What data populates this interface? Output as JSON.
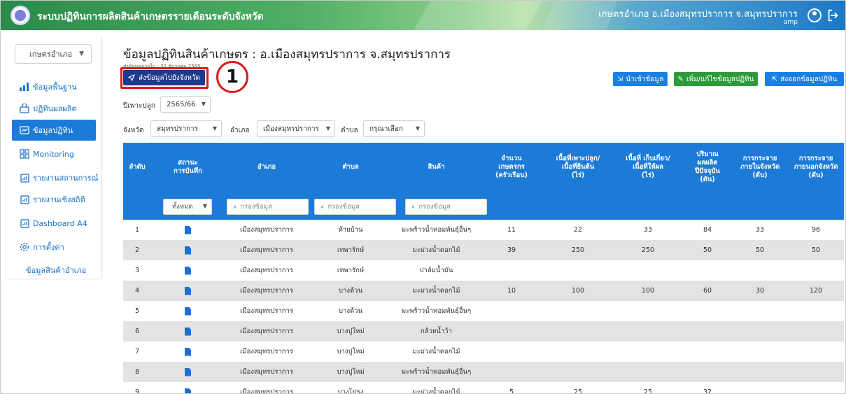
{
  "header": {
    "app_title": "ระบบปฏิทินการผลิตสินค้าเกษตรรายเดือนระดับจังหวัด",
    "user_office": "เกษตรอำเภอ อ.เมืองสมุทรปราการ จ.สมุทรปราการ",
    "user_name": "amp"
  },
  "sidebar": {
    "role": "เกษตรอำเภอ",
    "items": [
      {
        "label": "ข้อมูลพื้นฐาน",
        "icon": "bar-chart-icon"
      },
      {
        "label": "ปฏิทินผลผลิต",
        "icon": "bag-icon"
      },
      {
        "label": "ข้อมูลปฏิทิน",
        "icon": "calendar-chart-icon"
      },
      {
        "label": "Monitoring",
        "icon": "grid-icon"
      },
      {
        "label": "รายงานสถานการณ์",
        "icon": "report-icon"
      },
      {
        "label": "รายงานเชิงสถิติ",
        "icon": "report-icon"
      },
      {
        "label": "Dashboard A4",
        "icon": "report-icon"
      },
      {
        "label": "การตั้งค่า",
        "icon": "settings-icon"
      }
    ],
    "subitem": "ข้อมูลสินค้าอำเภอ"
  },
  "main": {
    "title": "ข้อมูลปฏิทินสินค้าเกษตร : อ.เมืองสมุทรปราการ จ.สมุทรปราการ",
    "last_sent": "ส่งข้อมูลภายใน : 31 ธันวาคม 2565",
    "send_button": "ส่งข้อมูลไปยังจังหวัด",
    "step_number": "1",
    "import_button": "นำเข้าข้อมูล",
    "add_button": "เพิ่ม/แก้ไขข้อมูลปฏิทิน",
    "export_button": "ส่งออกข้อมูลปฏิทิน",
    "season_label": "ปีเพาะปลูก",
    "season_value": "2565/66",
    "province_label": "จังหวัด",
    "province_value": "สมุทรปราการ",
    "district_label": "อำเภอ",
    "district_value": "เมืองสมุทรปราการ",
    "subdistrict_label": "ตำบล",
    "subdistrict_value": "กรุณาเลือก"
  },
  "table": {
    "headers": [
      "ลำดับ",
      "สถานะ\nการบันทึก",
      "อำเภอ",
      "ตำบล",
      "สินค้า",
      "จำนวน\nเกษตรกร\n(ครัวเรือน)",
      "เนื้อที่เพาะปลูก/\nเนื้อที่ยืนต้น\n(ไร่)",
      "เนื้อที่ เก็บเกี่ยว/\nเนื้อที่ให้ผล\n(ไร่)",
      "ปริมาณ\nผลผลิต\nปีปัจจุบัน\n(ตัน)",
      "การกระจาย\nภายในจังหวัด\n(ตัน)",
      "การกระจาย\nภายนอกจังหวัด\n(ตัน)"
    ],
    "filter": {
      "status_all": "ทั้งหมด",
      "search_placeholder": "กรองข้อมูล"
    },
    "rows": [
      {
        "no": "1",
        "district": "เมืองสมุทรปราการ",
        "subdistrict": "ท้ายบ้าน",
        "product": "มะพร้าวน้ำหอมพันธุ์อื่นๆ",
        "farmers": "11",
        "planted": "22",
        "harvest": "33",
        "output": "84",
        "in_prov": "33",
        "out_prov": "96"
      },
      {
        "no": "2",
        "district": "เมืองสมุทรปราการ",
        "subdistrict": "เทพารักษ์",
        "product": "มะม่วงน้ำดอกไม้",
        "farmers": "39",
        "planted": "250",
        "harvest": "250",
        "output": "50",
        "in_prov": "50",
        "out_prov": "50"
      },
      {
        "no": "3",
        "district": "เมืองสมุทรปราการ",
        "subdistrict": "เทพารักษ์",
        "product": "ปาล์มน้ำมัน",
        "farmers": "",
        "planted": "",
        "harvest": "",
        "output": "",
        "in_prov": "",
        "out_prov": ""
      },
      {
        "no": "4",
        "district": "เมืองสมุทรปราการ",
        "subdistrict": "บางด้วน",
        "product": "มะม่วงน้ำดอกไม้",
        "farmers": "10",
        "planted": "100",
        "harvest": "100",
        "output": "60",
        "in_prov": "30",
        "out_prov": "120"
      },
      {
        "no": "5",
        "district": "เมืองสมุทรปราการ",
        "subdistrict": "บางด้วน",
        "product": "มะพร้าวน้ำหอมพันธุ์อื่นๆ",
        "farmers": "",
        "planted": "",
        "harvest": "",
        "output": "",
        "in_prov": "",
        "out_prov": ""
      },
      {
        "no": "6",
        "district": "เมืองสมุทรปราการ",
        "subdistrict": "บางปูใหม่",
        "product": "กล้วยน้ำว้า",
        "farmers": "",
        "planted": "",
        "harvest": "",
        "output": "",
        "in_prov": "",
        "out_prov": ""
      },
      {
        "no": "7",
        "district": "เมืองสมุทรปราการ",
        "subdistrict": "บางปูใหม่",
        "product": "มะม่วงน้ำดอกไม้",
        "farmers": "",
        "planted": "",
        "harvest": "",
        "output": "",
        "in_prov": "",
        "out_prov": ""
      },
      {
        "no": "8",
        "district": "เมืองสมุทรปราการ",
        "subdistrict": "บางปูใหม่",
        "product": "มะพร้าวน้ำหอมพันธุ์อื่นๆ",
        "farmers": "",
        "planted": "",
        "harvest": "",
        "output": "",
        "in_prov": "",
        "out_prov": ""
      },
      {
        "no": "9",
        "district": "เมืองสมุทรปราการ",
        "subdistrict": "บางโปรง",
        "product": "มะม่วงน้ำดอกไม้",
        "farmers": "5",
        "planted": "25",
        "harvest": "25",
        "output": "32",
        "in_prov": "",
        "out_prov": ""
      }
    ]
  }
}
